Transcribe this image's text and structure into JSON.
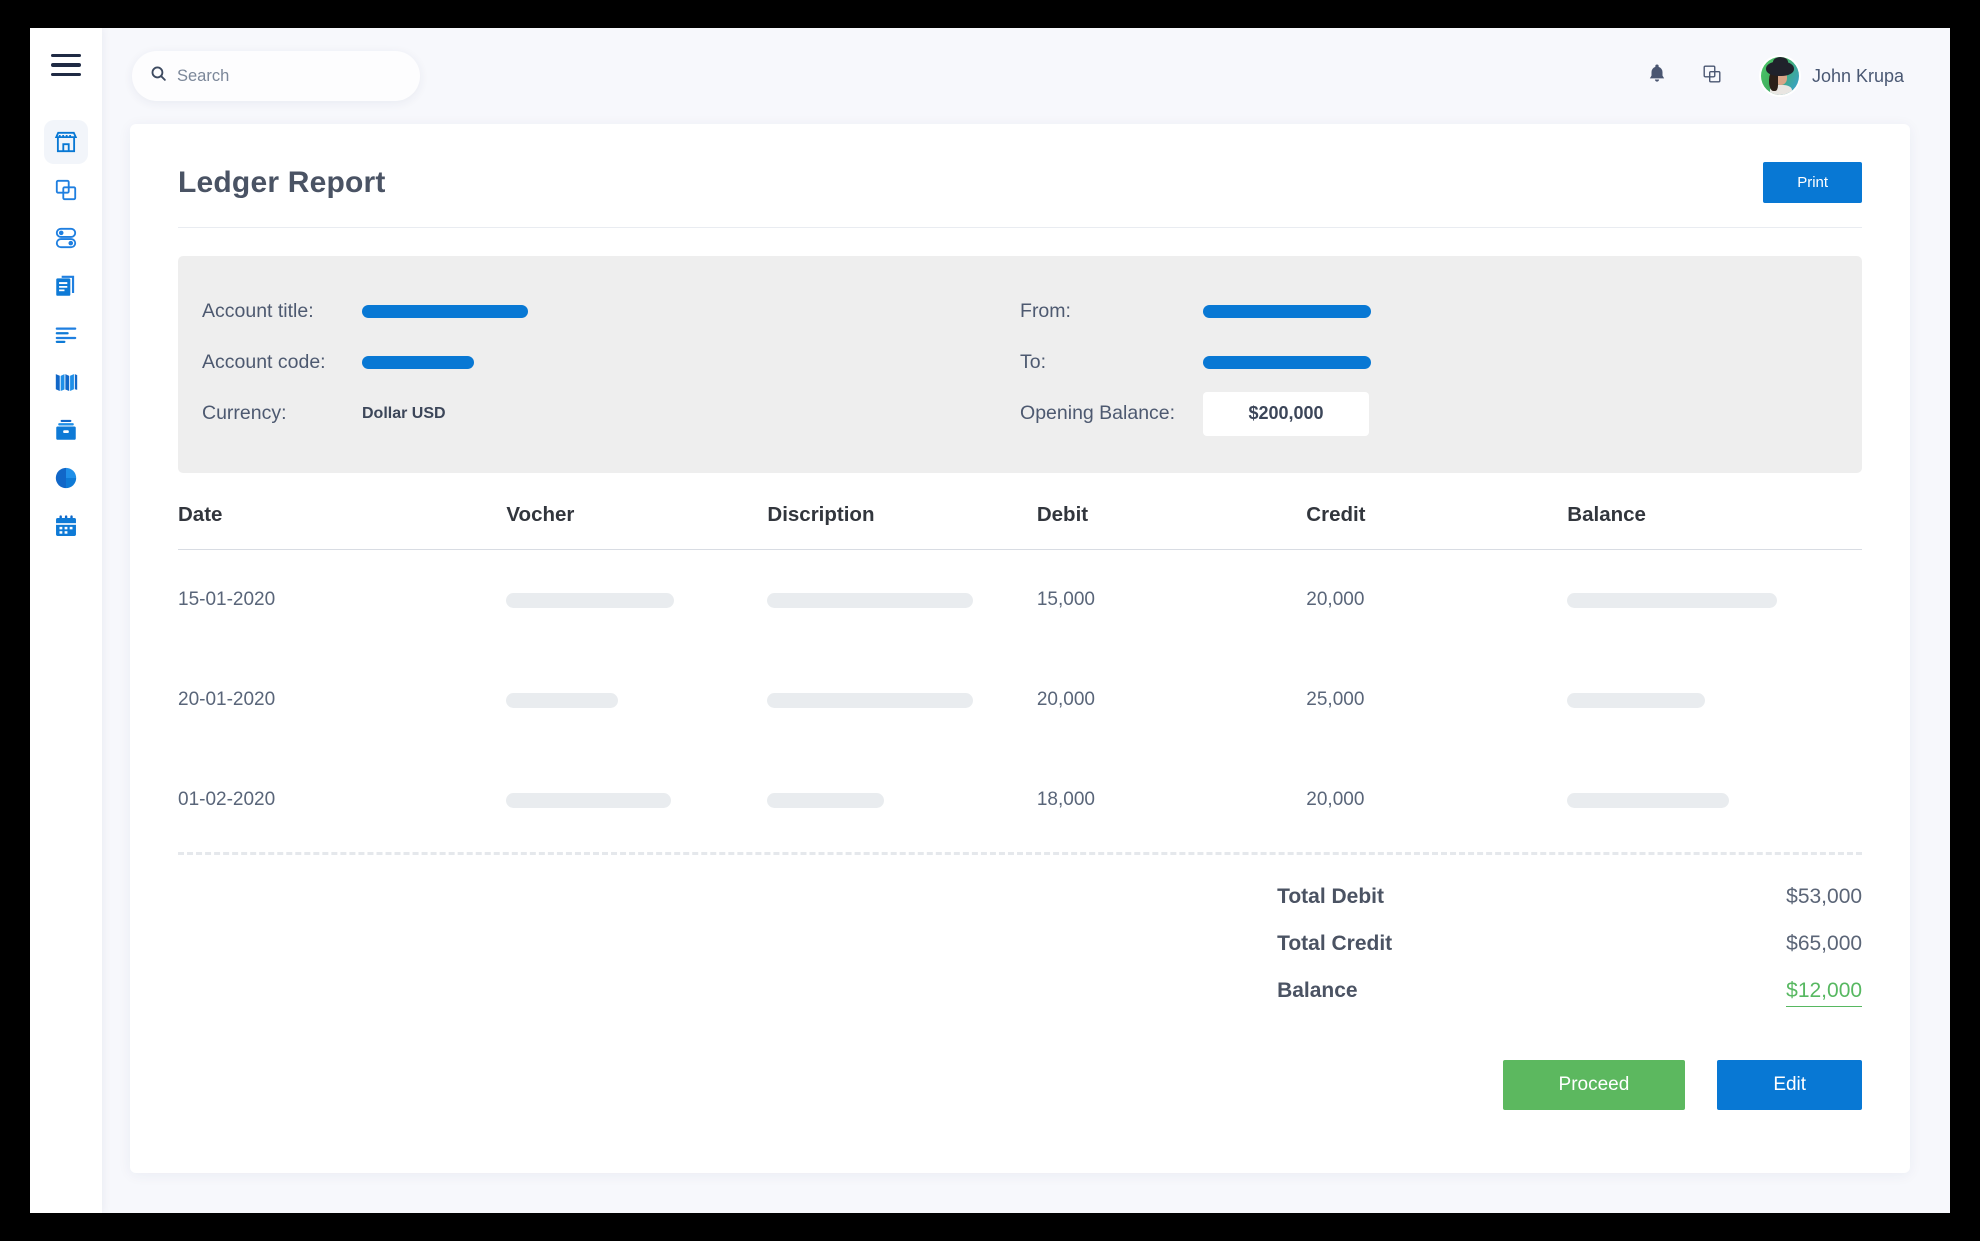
{
  "sidebar": {
    "menu_toggle": "hamburger-menu",
    "items": [
      {
        "name": "storefront",
        "icon": "store-icon",
        "active": true
      },
      {
        "name": "copy",
        "icon": "copy-icon",
        "active": false
      },
      {
        "name": "toggles",
        "icon": "toggles-icon",
        "active": false
      },
      {
        "name": "documents",
        "icon": "document-copy-icon",
        "active": false
      },
      {
        "name": "lines",
        "icon": "text-lines-icon",
        "active": false
      },
      {
        "name": "book",
        "icon": "open-book-icon",
        "active": false
      },
      {
        "name": "archive",
        "icon": "archive-box-icon",
        "active": false
      },
      {
        "name": "analytics",
        "icon": "pie-chart-icon",
        "active": false
      },
      {
        "name": "calendar",
        "icon": "calendar-icon",
        "active": false
      }
    ]
  },
  "topbar": {
    "search": {
      "value": "",
      "placeholder": "Search",
      "icon": "search-icon"
    },
    "notifications_icon": "bell-icon",
    "duplicate_icon": "copy-icon",
    "user": {
      "name": "John Krupa",
      "avatar": "user-avatar"
    }
  },
  "card": {
    "title": "Ledger Report",
    "print_label": "Print"
  },
  "info": {
    "left": [
      {
        "label": "Account title:",
        "type": "bar",
        "value": ""
      },
      {
        "label": "Account code:",
        "type": "bar",
        "value": ""
      },
      {
        "label": "Currency:",
        "type": "text",
        "value": "Dollar USD"
      }
    ],
    "right": [
      {
        "label": "From:",
        "type": "bar",
        "value": ""
      },
      {
        "label": "To:",
        "type": "bar",
        "value": ""
      },
      {
        "label": "Opening Balance:",
        "type": "box",
        "value": "$200,000"
      }
    ]
  },
  "table": {
    "columns": [
      "Date",
      "Vocher",
      "Discription",
      "Debit",
      "Credit",
      "Balance"
    ],
    "rows": [
      {
        "date": "15-01-2020",
        "vocher": "",
        "discription": "",
        "debit": "15,000",
        "credit": "20,000",
        "balance": ""
      },
      {
        "date": "20-01-2020",
        "vocher": "",
        "discription": "",
        "debit": "20,000",
        "credit": "25,000",
        "balance": ""
      },
      {
        "date": "01-02-2020",
        "vocher": "",
        "discription": "",
        "debit": "18,000",
        "credit": "20,000",
        "balance": ""
      }
    ]
  },
  "totals": [
    {
      "label": "Total Debit",
      "value": "$53,000",
      "accent": false
    },
    {
      "label": "Total Credit",
      "value": "$65,000",
      "accent": false
    },
    {
      "label": "Balance",
      "value": "$12,000",
      "accent": true
    }
  ],
  "actions": {
    "proceed_label": "Proceed",
    "edit_label": "Edit"
  },
  "colors": {
    "brand_blue": "#0878d4",
    "accent_green": "#57b861",
    "proceed_green": "#5cb85f",
    "panel_gray": "#eeeeee",
    "page_bg": "#f7f8fc",
    "placeholder_gray": "#e9ecef"
  }
}
